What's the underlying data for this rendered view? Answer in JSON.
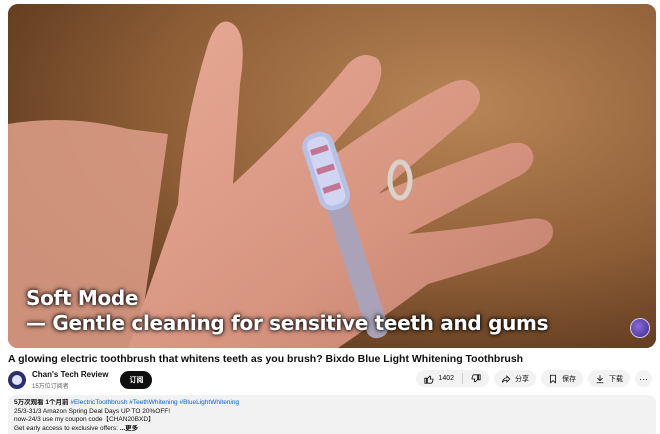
{
  "video": {
    "caption_line1": "Soft Mode",
    "caption_line2": "— Gentle cleaning for sensitive teeth and gums"
  },
  "title": "A glowing electric toothbrush that whitens teeth as you brush? Bixdo Blue Light Whitening Toothbrush",
  "channel": {
    "name": "Chan's Tech Review",
    "subscribers": "15万位订阅者",
    "subscribe_label": "订阅"
  },
  "actions": {
    "like_count": "1402",
    "share_label": "分享",
    "save_label": "保存",
    "download_label": "下载",
    "more_label": "···"
  },
  "description": {
    "views_time": "5万次观看  1个月前",
    "hashtags": "#ElectricToothbrush #TeethWhitening #BlueLightWhitening",
    "line1": "25/3-31/3 Amazon Spring Deal Days UP TO 20%OFF!",
    "line2": "now-24/3  use my coupon code【CHAN20BXD】",
    "line3": "Get early access to exclusive offers: ",
    "more_label": "...更多"
  }
}
